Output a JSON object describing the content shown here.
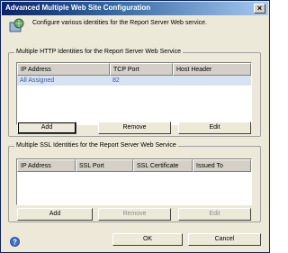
{
  "window": {
    "title": "Advanced Multiple Web Site Configuration",
    "close": "×"
  },
  "intro": "Configure various identities for the Report Server Web service.",
  "http_group": {
    "label": "Multiple HTTP Identities for the Report Server Web Service",
    "columns": [
      "IP Address",
      "TCP Port",
      "Host Header"
    ],
    "rows": [
      {
        "ip": "All Assigned",
        "port": "82",
        "host": ""
      }
    ],
    "buttons": {
      "add": "Add",
      "remove": "Remove",
      "edit": "Edit"
    }
  },
  "ssl_group": {
    "label": "Multiple SSL Identities for the Report Server Web Service",
    "columns": [
      "IP Address",
      "SSL Port",
      "SSL Certificate",
      "Issued To"
    ],
    "buttons": {
      "add": "Add",
      "remove": "Remove",
      "edit": "Edit"
    }
  },
  "footer": {
    "ok": "OK",
    "cancel": "Cancel"
  },
  "colors": {
    "titlebar": "#0a246a",
    "selected_row": "#d7e3f2",
    "dialog_bg": "#ece9d8"
  }
}
